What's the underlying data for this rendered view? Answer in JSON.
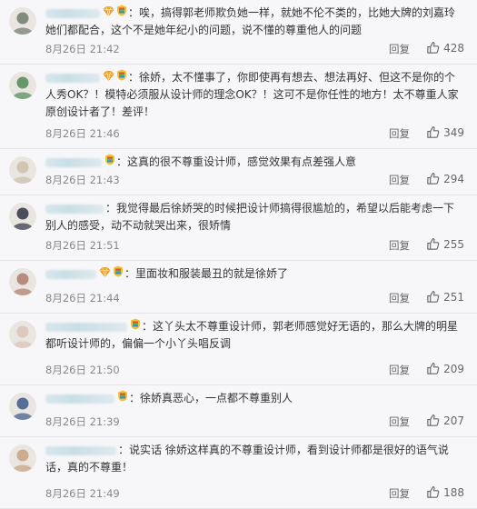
{
  "comments": [
    {
      "avatar_color": "#6e7a6c",
      "user_width": 60,
      "badges": [
        "vip-diamond",
        "rainbow-shield"
      ],
      "text": "：唉，搞得郭老师欺负她一样，就她不伦不类的，比她大牌的刘嘉玲她们都配合，这个不是她年纪小的问题，说不懂的尊重他人的问题",
      "date": "8月26日",
      "time": "21:42",
      "reply": "回复",
      "likes": "428"
    },
    {
      "avatar_color": "#4f8a55",
      "user_width": 60,
      "badges": [
        "vip-diamond",
        "rainbow-shield"
      ],
      "text": "：徐娇，太不懂事了，你即使再有想去、想法再好、但这不是你的个人秀OK？！模特必须服从设计师的理念OK？！这可不是你任性的地方！太不尊重人家原创设计者了！差评！",
      "date": "8月26日",
      "time": "21:46",
      "reply": "回复",
      "likes": "349"
    },
    {
      "avatar_color": "#c9bfa8",
      "user_width": 62,
      "badges": [
        "rainbow-shield"
      ],
      "text": "：这真的很不尊重设计师，感觉效果有点差强人意",
      "date": "8月26日",
      "time": "21:43",
      "reply": "回复",
      "likes": "294"
    },
    {
      "avatar_color": "#2f3340",
      "user_width": 64,
      "badges": [],
      "text": "：我觉得最后徐娇哭的时候把设计师搞得很尴尬的，希望以后能考虑一下别人的感受，动不动就哭出来，很矫情",
      "date": "8月26日",
      "time": "21:51",
      "reply": "回复",
      "likes": "255"
    },
    {
      "avatar_color": "#b07a6a",
      "user_width": 56,
      "badges": [
        "vip-diamond",
        "rainbow-shield"
      ],
      "text": "：里面妆和服装最丑的就是徐娇了",
      "date": "8月26日",
      "time": "21:44",
      "reply": "回复",
      "likes": "251"
    },
    {
      "avatar_color": "#d9c2b8",
      "user_width": 90,
      "badges": [
        "rainbow-shield"
      ],
      "text": "：这丫头太不尊重设计师，郭老师感觉好无语的，那么大牌的明星都听设计师的，偏偏一个小丫头唱反调",
      "date": "8月26日",
      "time": "21:50",
      "reply": "回复",
      "likes": "209"
    },
    {
      "avatar_color": "#3a5a8c",
      "user_width": 76,
      "badges": [
        "rainbow-shield"
      ],
      "text": "：徐娇真恶心，一点都不尊重别人",
      "date": "8月26日",
      "time": "21:39",
      "reply": "回复",
      "likes": "207"
    },
    {
      "avatar_color": "#c8a080",
      "user_width": 78,
      "badges": [],
      "text": "：说实话 徐娇这样真的不尊重设计师，看到设计师都是很好的语气说话，真的不尊重！",
      "date": "8月26日",
      "time": "21:49",
      "reply": "回复",
      "likes": "188"
    }
  ]
}
